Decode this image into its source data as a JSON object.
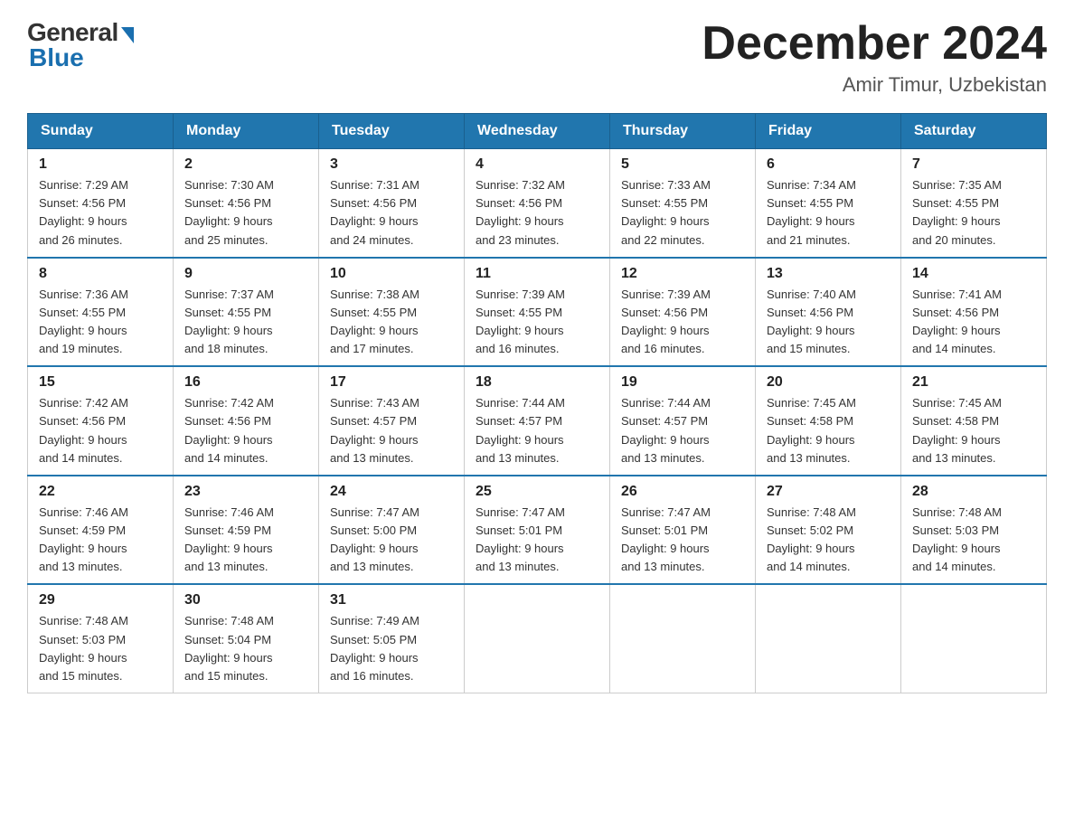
{
  "header": {
    "logo_general": "General",
    "logo_blue": "Blue",
    "month_title": "December 2024",
    "location": "Amir Timur, Uzbekistan"
  },
  "days_of_week": [
    "Sunday",
    "Monday",
    "Tuesday",
    "Wednesday",
    "Thursday",
    "Friday",
    "Saturday"
  ],
  "weeks": [
    [
      {
        "day": "1",
        "sunrise": "7:29 AM",
        "sunset": "4:56 PM",
        "daylight": "9 hours and 26 minutes."
      },
      {
        "day": "2",
        "sunrise": "7:30 AM",
        "sunset": "4:56 PM",
        "daylight": "9 hours and 25 minutes."
      },
      {
        "day": "3",
        "sunrise": "7:31 AM",
        "sunset": "4:56 PM",
        "daylight": "9 hours and 24 minutes."
      },
      {
        "day": "4",
        "sunrise": "7:32 AM",
        "sunset": "4:56 PM",
        "daylight": "9 hours and 23 minutes."
      },
      {
        "day": "5",
        "sunrise": "7:33 AM",
        "sunset": "4:55 PM",
        "daylight": "9 hours and 22 minutes."
      },
      {
        "day": "6",
        "sunrise": "7:34 AM",
        "sunset": "4:55 PM",
        "daylight": "9 hours and 21 minutes."
      },
      {
        "day": "7",
        "sunrise": "7:35 AM",
        "sunset": "4:55 PM",
        "daylight": "9 hours and 20 minutes."
      }
    ],
    [
      {
        "day": "8",
        "sunrise": "7:36 AM",
        "sunset": "4:55 PM",
        "daylight": "9 hours and 19 minutes."
      },
      {
        "day": "9",
        "sunrise": "7:37 AM",
        "sunset": "4:55 PM",
        "daylight": "9 hours and 18 minutes."
      },
      {
        "day": "10",
        "sunrise": "7:38 AM",
        "sunset": "4:55 PM",
        "daylight": "9 hours and 17 minutes."
      },
      {
        "day": "11",
        "sunrise": "7:39 AM",
        "sunset": "4:55 PM",
        "daylight": "9 hours and 16 minutes."
      },
      {
        "day": "12",
        "sunrise": "7:39 AM",
        "sunset": "4:56 PM",
        "daylight": "9 hours and 16 minutes."
      },
      {
        "day": "13",
        "sunrise": "7:40 AM",
        "sunset": "4:56 PM",
        "daylight": "9 hours and 15 minutes."
      },
      {
        "day": "14",
        "sunrise": "7:41 AM",
        "sunset": "4:56 PM",
        "daylight": "9 hours and 14 minutes."
      }
    ],
    [
      {
        "day": "15",
        "sunrise": "7:42 AM",
        "sunset": "4:56 PM",
        "daylight": "9 hours and 14 minutes."
      },
      {
        "day": "16",
        "sunrise": "7:42 AM",
        "sunset": "4:56 PM",
        "daylight": "9 hours and 14 minutes."
      },
      {
        "day": "17",
        "sunrise": "7:43 AM",
        "sunset": "4:57 PM",
        "daylight": "9 hours and 13 minutes."
      },
      {
        "day": "18",
        "sunrise": "7:44 AM",
        "sunset": "4:57 PM",
        "daylight": "9 hours and 13 minutes."
      },
      {
        "day": "19",
        "sunrise": "7:44 AM",
        "sunset": "4:57 PM",
        "daylight": "9 hours and 13 minutes."
      },
      {
        "day": "20",
        "sunrise": "7:45 AM",
        "sunset": "4:58 PM",
        "daylight": "9 hours and 13 minutes."
      },
      {
        "day": "21",
        "sunrise": "7:45 AM",
        "sunset": "4:58 PM",
        "daylight": "9 hours and 13 minutes."
      }
    ],
    [
      {
        "day": "22",
        "sunrise": "7:46 AM",
        "sunset": "4:59 PM",
        "daylight": "9 hours and 13 minutes."
      },
      {
        "day": "23",
        "sunrise": "7:46 AM",
        "sunset": "4:59 PM",
        "daylight": "9 hours and 13 minutes."
      },
      {
        "day": "24",
        "sunrise": "7:47 AM",
        "sunset": "5:00 PM",
        "daylight": "9 hours and 13 minutes."
      },
      {
        "day": "25",
        "sunrise": "7:47 AM",
        "sunset": "5:01 PM",
        "daylight": "9 hours and 13 minutes."
      },
      {
        "day": "26",
        "sunrise": "7:47 AM",
        "sunset": "5:01 PM",
        "daylight": "9 hours and 13 minutes."
      },
      {
        "day": "27",
        "sunrise": "7:48 AM",
        "sunset": "5:02 PM",
        "daylight": "9 hours and 14 minutes."
      },
      {
        "day": "28",
        "sunrise": "7:48 AM",
        "sunset": "5:03 PM",
        "daylight": "9 hours and 14 minutes."
      }
    ],
    [
      {
        "day": "29",
        "sunrise": "7:48 AM",
        "sunset": "5:03 PM",
        "daylight": "9 hours and 15 minutes."
      },
      {
        "day": "30",
        "sunrise": "7:48 AM",
        "sunset": "5:04 PM",
        "daylight": "9 hours and 15 minutes."
      },
      {
        "day": "31",
        "sunrise": "7:49 AM",
        "sunset": "5:05 PM",
        "daylight": "9 hours and 16 minutes."
      },
      null,
      null,
      null,
      null
    ]
  ],
  "labels": {
    "sunrise_prefix": "Sunrise: ",
    "sunset_prefix": "Sunset: ",
    "daylight_prefix": "Daylight: "
  }
}
